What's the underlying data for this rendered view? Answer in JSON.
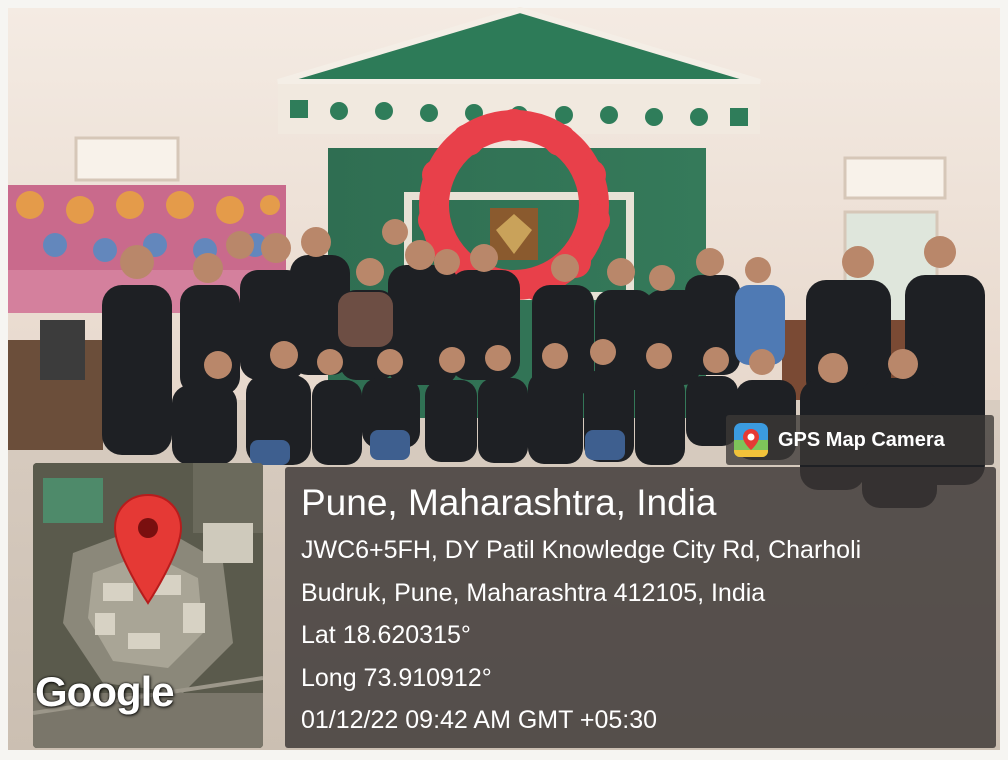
{
  "overlay": {
    "app_name": "GPS Map Camera",
    "app_icon": "gps-map-camera-icon",
    "map": {
      "provider_label": "Google",
      "marker_icon": "map-pin-icon"
    },
    "location": {
      "city": "Pune, Maharashtra, India",
      "address_line1": "JWC6+5FH, DY Patil Knowledge City Rd, Charholi",
      "address_line2": "Budruk, Pune, Maharashtra 412105, India",
      "latitude": "Lat 18.620315°",
      "longitude": "Long 73.910912°",
      "timestamp": "01/12/22 09:42 AM GMT +05:30"
    }
  },
  "photo": {
    "scene": "group-photo",
    "colors": {
      "wall": "#efe3d8",
      "pediment": "#2f7a58",
      "balloon_ring": "#e8404a",
      "clothing": "#1e2024",
      "floor": "#d9cdbf",
      "panel_bg": "#3a3634",
      "pin": "#e53935"
    }
  }
}
